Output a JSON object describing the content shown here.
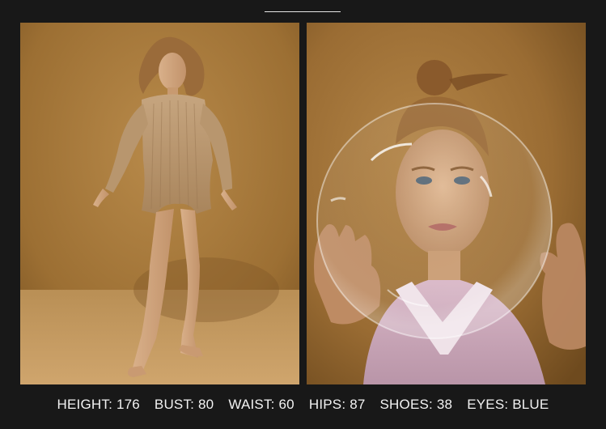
{
  "photos": [
    {
      "alt": "model full body in beige knit romper"
    },
    {
      "alt": "model with glass sphere in pink knit polo"
    }
  ],
  "stats": [
    {
      "label": "HEIGHT:",
      "value": "176"
    },
    {
      "label": "BUST:",
      "value": "80"
    },
    {
      "label": "WAIST:",
      "value": "60"
    },
    {
      "label": "HIPS:",
      "value": "87"
    },
    {
      "label": "SHOES:",
      "value": "38"
    },
    {
      "label": "EYES:",
      "value": "BLUE"
    }
  ]
}
